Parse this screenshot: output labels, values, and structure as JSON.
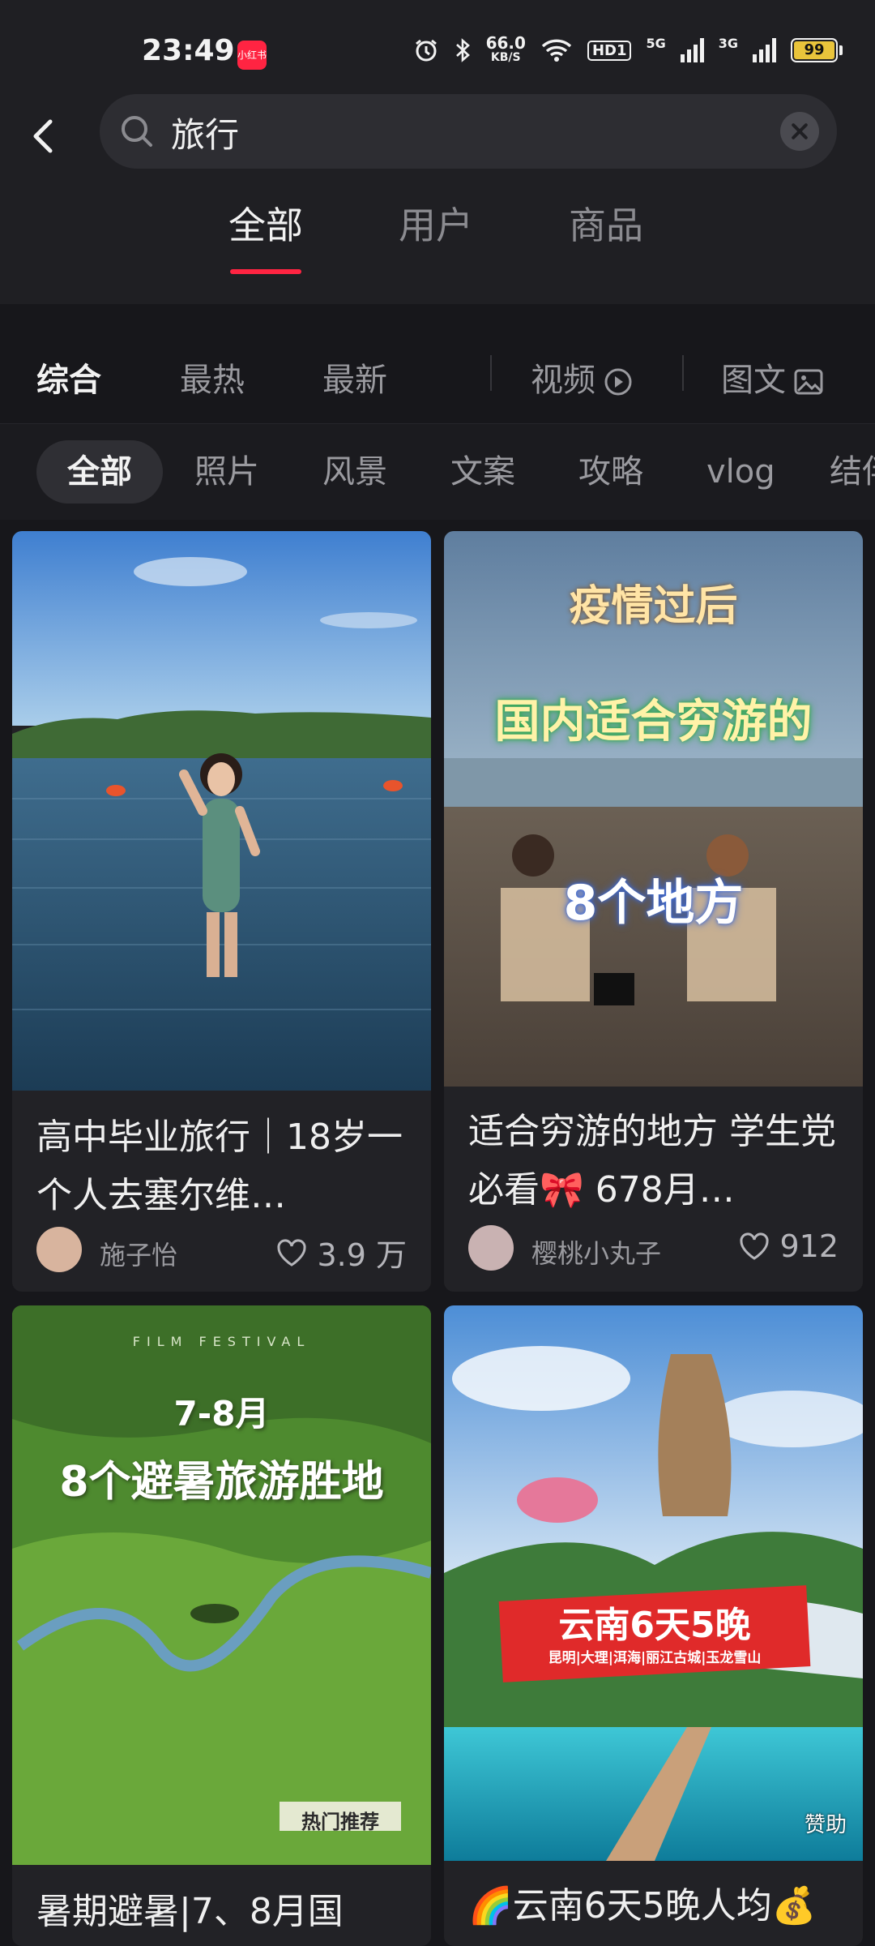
{
  "status_bar": {
    "time": "23:49",
    "speed_value": "66.0",
    "speed_unit": "KB/S",
    "hd_badge": "HD1",
    "net1": "5G",
    "net2": "3G",
    "battery": "99",
    "icons": [
      "alarm-icon",
      "bluetooth-icon",
      "wifi-icon",
      "signal-icon",
      "battery-icon"
    ]
  },
  "search": {
    "query": "旅行",
    "icons": [
      "back-icon",
      "search-icon",
      "clear-icon"
    ]
  },
  "tabs": [
    {
      "label": "全部",
      "active": true
    },
    {
      "label": "用户",
      "active": false
    },
    {
      "label": "商品",
      "active": false
    }
  ],
  "sort": {
    "options": [
      "综合",
      "最热",
      "最新"
    ],
    "active": "综合",
    "type_video": "视频",
    "type_image": "图文"
  },
  "chips": [
    "全部",
    "照片",
    "风景",
    "文案",
    "攻略",
    "vlog",
    "结伴"
  ],
  "cards": [
    {
      "title": "高中毕业旅行｜18岁一个人去塞尔维…",
      "author": "施子怡",
      "likes": "3.9 万"
    },
    {
      "overlay_line1": "疫情过后",
      "overlay_line2": "国内适合穷游的",
      "overlay_line3": "8个地方",
      "title": "适合穷游的地方 学生党必看🎀 678月…",
      "author": "樱桃小丸子",
      "likes": "912"
    },
    {
      "overlay_small": "FILM FESTIVAL",
      "overlay_line1": "7-8月",
      "overlay_line2": "8个避暑旅游胜地",
      "overlay_tag": "热门推荐",
      "title": "暑期避暑|7、8月国"
    },
    {
      "overlay_line1": "云南6天5晚",
      "overlay_line2": "昆明|大理|洱海|丽江古城|玉龙雪山",
      "sponsor": "赞助",
      "title": "🌈云南6天5晚人均💰"
    }
  ],
  "colors": {
    "accent": "#ff2442",
    "background": "#17171b",
    "surface": "#1f1f23",
    "card": "#222226"
  }
}
